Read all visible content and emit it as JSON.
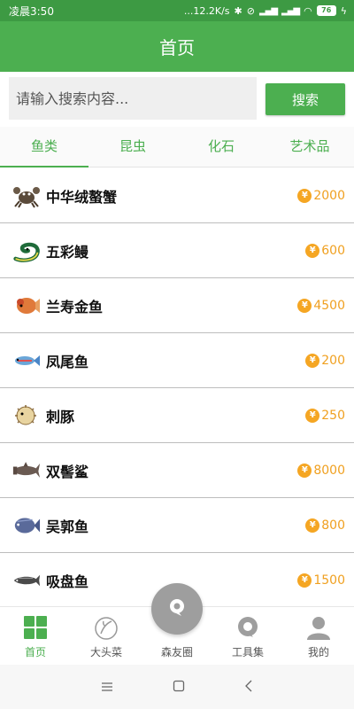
{
  "status": {
    "time": "凌晨3:50",
    "net_speed": "...12.2K/s",
    "battery": "76"
  },
  "header": {
    "title": "首页"
  },
  "search": {
    "placeholder": "请输入搜索内容...",
    "button_label": "搜索"
  },
  "tabs": [
    {
      "label": "鱼类",
      "active": true
    },
    {
      "label": "昆虫"
    },
    {
      "label": "化石"
    },
    {
      "label": "艺术品"
    }
  ],
  "items": [
    {
      "name": "中华绒螯蟹",
      "price": "2000",
      "icon": "crab-icon"
    },
    {
      "name": "五彩鳗",
      "price": "600",
      "icon": "eel-icon"
    },
    {
      "name": "兰寿金鱼",
      "price": "4500",
      "icon": "goldfish-icon"
    },
    {
      "name": "凤尾鱼",
      "price": "200",
      "icon": "guppy-icon"
    },
    {
      "name": "刺豚",
      "price": "250",
      "icon": "pufferfish-icon"
    },
    {
      "name": "双髻鲨",
      "price": "8000",
      "icon": "hammerhead-icon"
    },
    {
      "name": "吴郭鱼",
      "price": "800",
      "icon": "tilapia-icon"
    },
    {
      "name": "吸盘鱼",
      "price": "1500",
      "icon": "remora-icon"
    }
  ],
  "coin_symbol": "¥",
  "bottom_nav": [
    {
      "label": "首页",
      "icon": "grid-icon",
      "active": true
    },
    {
      "label": "大头菜",
      "icon": "turnip-icon"
    },
    {
      "label": "森友圈",
      "icon": "chat-bubble-icon"
    },
    {
      "label": "工具集",
      "icon": "tools-icon"
    },
    {
      "label": "我的",
      "icon": "profile-icon"
    }
  ],
  "colors": {
    "primary": "#4caf50",
    "status_bar": "#3d9a43",
    "price": "#f0a020",
    "fab": "#9e9e9e"
  }
}
